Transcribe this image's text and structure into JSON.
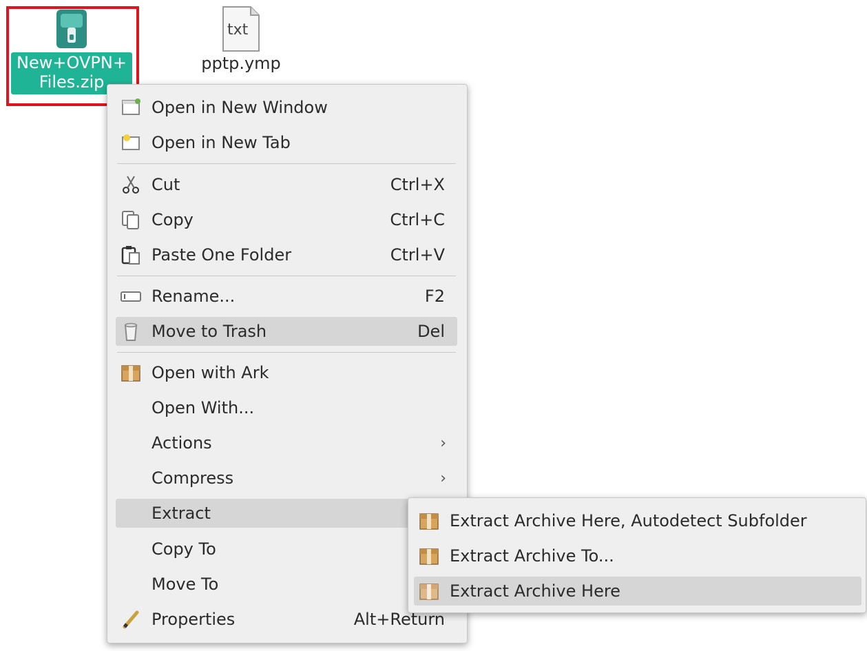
{
  "desktop": {
    "files": [
      {
        "name": "New+OVPN+\nFiles.zip",
        "icon": "zip-archive-icon",
        "selected": true
      },
      {
        "name": "pptp.ymp",
        "icon": "text-file-icon",
        "selected": false
      }
    ],
    "txt_glyph": "txt"
  },
  "colors": {
    "selection_fill": "#1fb495",
    "annotation_box": "#e0141e",
    "menu_bg": "#efefef",
    "highlight": "#d6d6d6"
  },
  "context_menu": {
    "items": [
      {
        "label": "Open in New Window",
        "icon": "new-window-icon",
        "shortcut": ""
      },
      {
        "label": "Open in New Tab",
        "icon": "new-tab-icon",
        "shortcut": ""
      },
      {
        "label": "Cut",
        "icon": "scissors-icon",
        "shortcut": "Ctrl+X"
      },
      {
        "label": "Copy",
        "icon": "copy-icon",
        "shortcut": "Ctrl+C"
      },
      {
        "label": "Paste One Folder",
        "icon": "paste-icon",
        "shortcut": "Ctrl+V"
      },
      {
        "label": "Rename...",
        "icon": "rename-icon",
        "shortcut": "F2"
      },
      {
        "label": "Move to Trash",
        "icon": "trash-icon",
        "shortcut": "Del",
        "highlighted": true
      },
      {
        "label": "Open with Ark",
        "icon": "ark-archive-icon",
        "shortcut": ""
      },
      {
        "label": "Open With...",
        "icon": "",
        "shortcut": ""
      },
      {
        "label": "Actions",
        "icon": "",
        "submenu": true
      },
      {
        "label": "Compress",
        "icon": "",
        "submenu": true
      },
      {
        "label": "Extract",
        "icon": "",
        "highlighted": true
      },
      {
        "label": "Copy To",
        "icon": "",
        "shortcut": ""
      },
      {
        "label": "Move To",
        "icon": "",
        "shortcut": ""
      },
      {
        "label": "Properties",
        "icon": "properties-pencil-icon",
        "shortcut": "Alt+Return"
      }
    ],
    "submenu_arrow": "›"
  },
  "extract_submenu": {
    "items": [
      {
        "label": "Extract Archive Here, Autodetect Subfolder",
        "icon": "archive-box-icon"
      },
      {
        "label": "Extract Archive To...",
        "icon": "archive-box-icon"
      },
      {
        "label": "Extract Archive Here",
        "icon": "archive-box-icon",
        "highlighted": true
      }
    ]
  }
}
